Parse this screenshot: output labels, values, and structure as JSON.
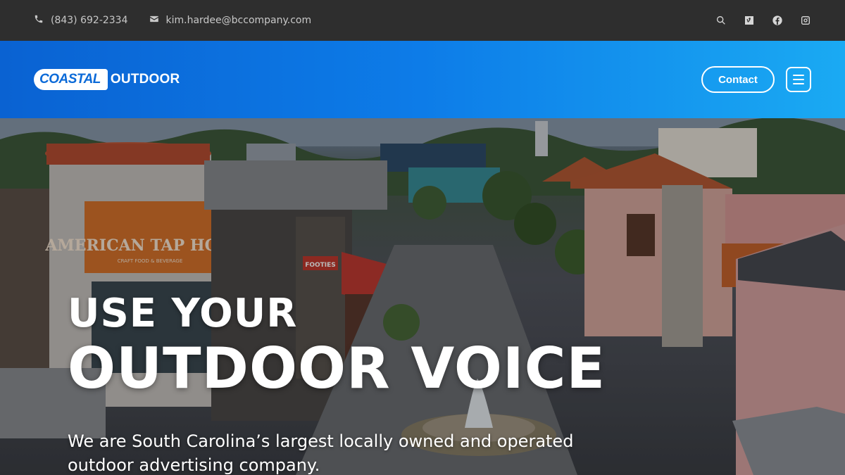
{
  "topbar": {
    "phone": "(843) 692-2334",
    "email": "kim.hardee@bccompany.com",
    "icons": [
      "search-icon",
      "vimeo-icon",
      "facebook-icon",
      "instagram-icon"
    ]
  },
  "header": {
    "logo_part1": "COASTAL",
    "logo_part2": "OUTDOOR",
    "contact_label": "Contact"
  },
  "hero": {
    "headline_line1": "USE YOUR",
    "headline_line2": "OUTDOOR VOICE",
    "subheadline": "We are South Carolina’s largest locally owned and operated outdoor advertising company.",
    "sign_text": "AMERICAN TAP HOUSE",
    "sign_subtext": "CRAFT FOOD & BEVERAGE",
    "shop_sign": "FOOTIES"
  },
  "colors": {
    "topbar_bg": "#2e2e2e",
    "header_gradient_start": "#0a62d2",
    "header_gradient_end": "#1aaaf3",
    "text_white": "#ffffff"
  }
}
